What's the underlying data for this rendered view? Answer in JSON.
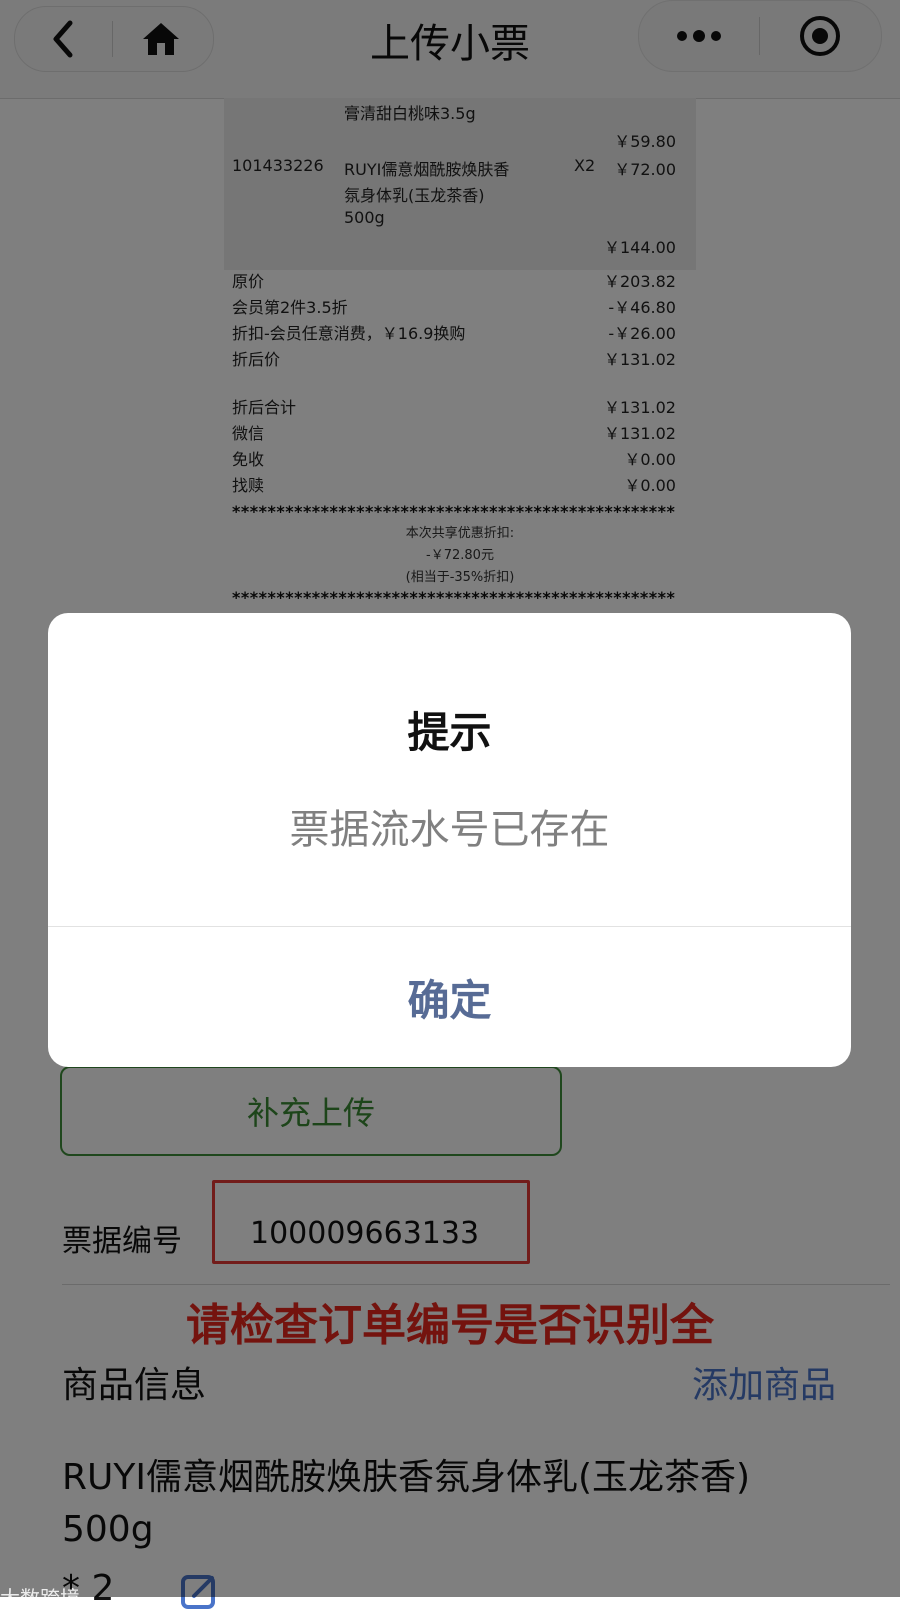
{
  "nav": {
    "title": "上传小票"
  },
  "receipt": {
    "item_prev_name_tail": "膏清甜白桃味3.5g",
    "item_prev_subtotal": "￥59.80",
    "item": {
      "code": "101433226",
      "name_line1": "RUYI儒意烟酰胺焕肤香",
      "name_line2": "氛身体乳(玉龙茶香)",
      "name_line3": "500g",
      "qty": "X2",
      "price": "￥72.00",
      "subtotal": "￥144.00"
    },
    "summary": [
      {
        "label": "原价",
        "value": "￥203.82"
      },
      {
        "label": "会员第2件3.5折",
        "value": "-￥46.80"
      },
      {
        "label": "折扣-会员任意消费，￥16.9换购",
        "value": "-￥26.00"
      },
      {
        "label": "折后价",
        "value": "￥131.02"
      }
    ],
    "totals": [
      {
        "label": "折后合计",
        "value": "￥131.02"
      },
      {
        "label": "微信",
        "value": "￥131.02"
      },
      {
        "label": "免收",
        "value": "￥0.00"
      },
      {
        "label": "找赎",
        "value": "￥0.00"
      }
    ],
    "stars": "**************************************************",
    "discount_title": "本次共享优惠折扣:",
    "discount_amount": "-￥72.80元",
    "discount_equiv": "(相当于-35%折扣)"
  },
  "form": {
    "supplement_button": "补充上传",
    "ticket_label": "票据编号",
    "ticket_value": "100009663133",
    "warning": "请检查订单编号是否识别全",
    "goods_label": "商品信息",
    "add_goods": "添加商品",
    "product_name": "RUYI儒意烟酰胺焕肤香氛身体乳(玉龙茶香) 500g",
    "qty": "* 2"
  },
  "watermark": "大数跨境",
  "modal": {
    "title": "提示",
    "content": "票据流水号已存在",
    "confirm": "确定"
  },
  "colors": {
    "accent_green": "#3a8a34",
    "warning_red": "#e8261c",
    "link_blue": "#4a74c9",
    "confirm_blue": "#576b95"
  }
}
